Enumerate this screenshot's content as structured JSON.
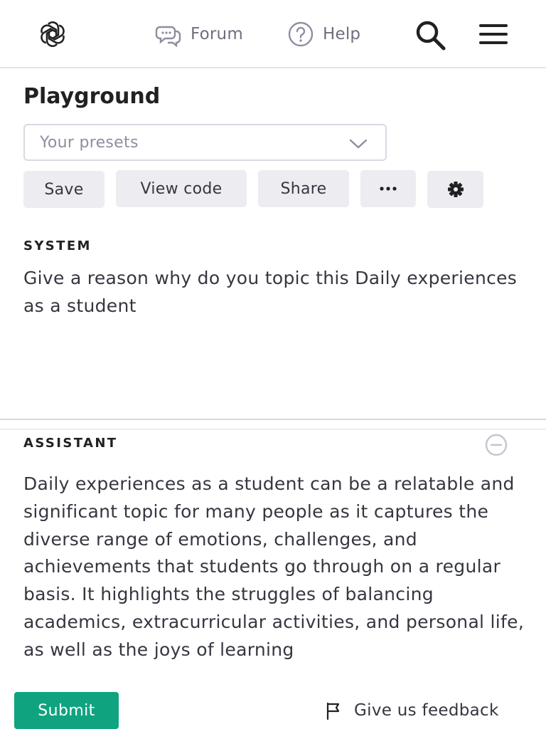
{
  "nav": {
    "logo_icon": "openai-logo-icon",
    "forum_label": "Forum",
    "help_label": "Help",
    "search_icon": "search-icon",
    "menu_icon": "hamburger-menu-icon"
  },
  "header": {
    "title": "Playground",
    "presets_placeholder": "Your presets"
  },
  "toolbar": {
    "save_label": "Save",
    "view_code_label": "View code",
    "share_label": "Share",
    "more_label": "···",
    "settings_icon": "gear-icon"
  },
  "system": {
    "label": "SYSTEM",
    "text": "Give a reason why do you topic this Daily experiences as a student"
  },
  "assistant": {
    "label": "ASSISTANT",
    "text": "Daily experiences as a student can be a relatable and significant topic for many people as it captures the diverse range of emotions, challenges, and achievements that students go through on a regular basis. It highlights the struggles of balancing academics, extracurricular activities, and personal life, as well as the joys of learning"
  },
  "footer": {
    "submit_label": "Submit",
    "feedback_label": "Give us feedback"
  },
  "colors": {
    "accent": "#10a37f",
    "muted_text": "#6e6e80",
    "button_bg": "#ececf1"
  }
}
